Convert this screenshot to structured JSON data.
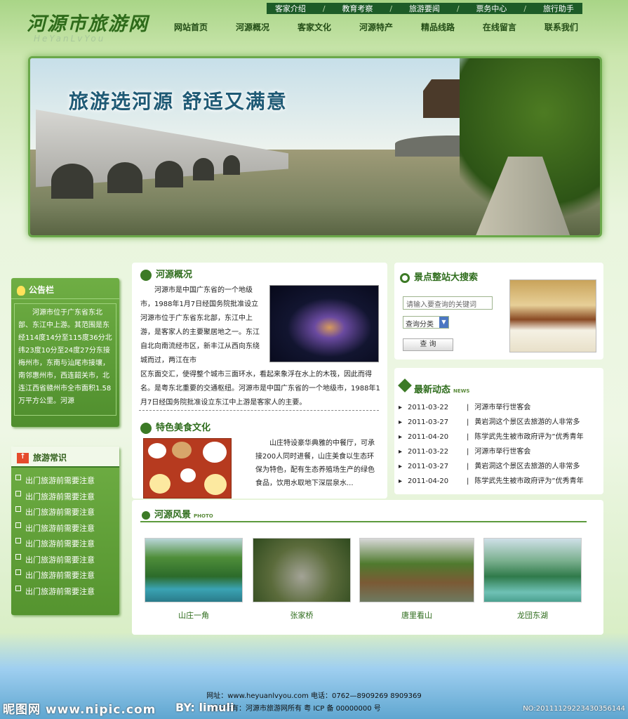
{
  "header": {
    "logo": "河源市旅游网",
    "logo_sub": "HeYanLvYou",
    "top_links": [
      "客家介绍",
      "教育考察",
      "旅游要闻",
      "票务中心",
      "旅行助手"
    ],
    "nav": [
      "网站首页",
      "河源概况",
      "客家文化",
      "河源特产",
      "精品线路",
      "在线留言",
      "联系我们"
    ]
  },
  "banner": {
    "slogan": "旅游选河源  舒适又满意"
  },
  "notice": {
    "title": "公告栏",
    "text": "河源市位于广东省东北部、东江中上游。其范围是东经114度14分至115度36分北纬23度10分至24度27分东接梅州市，东南与汕尾市接壤，南邻惠州市，西连韶关市，北连江西省赣州市全市面积1.58万平方公里。河源"
  },
  "tips": {
    "title": "旅游常识",
    "up": "↑",
    "items": [
      "出门旅游前需要注意",
      "出门旅游前需要注意",
      "出门旅游前需要注意",
      "出门旅游前需要注意",
      "出门旅游前需要注意",
      "出门旅游前需要注意",
      "出门旅游前需要注意",
      "出门旅游前需要注意"
    ]
  },
  "about": {
    "title": "河源概况",
    "text1": "河源市是中国广东省的一个地级市，1988年1月7日经国务院批准设立河源市位于广东省东北部，东江中上游，是客家人的主要聚居地之一。东江自北向南流经市区，新丰江从西向东绕城而过，两江在市",
    "text2": "区东面交汇，使得整个城市三面环水，看起来象浮在水上的木筏，因此而得名。是粤东北重要的交通枢纽。河源市是中国广东省的一个地级市，1988年1月7日经国务院批准设立东江中上游是客家人的主要。"
  },
  "food": {
    "title": "特色美食文化",
    "text": "山庄特设豪华典雅的中餐厅，可承接200人同时进餐，山庄美食以生态环保为特色，配有生态养殖场生产的绿色食品，饮用水取地下深层泉水..."
  },
  "search": {
    "title": "景点整站大搜索",
    "placeholder": "请输入要查询的关键词",
    "category": "查询分类",
    "button": "查 询"
  },
  "news": {
    "title": "最新动态",
    "title_en": "NEWS",
    "items": [
      {
        "date": "2011-03-22",
        "title": "河源市举行世客会"
      },
      {
        "date": "2011-03-27",
        "title": "黄岩洞这个景区去旅游的人非常多"
      },
      {
        "date": "2011-04-20",
        "title": "陈学武先生被市政府评为”优秀青年"
      },
      {
        "date": "2011-03-22",
        "title": "河源市举行世客会"
      },
      {
        "date": "2011-03-27",
        "title": "黄岩洞这个景区去旅游的人非常多"
      },
      {
        "date": "2011-04-20",
        "title": "陈学武先生被市政府评为”优秀青年"
      }
    ]
  },
  "scenery": {
    "title": "河源风景",
    "title_en": "PHOTO",
    "items": [
      "山庄一角",
      "张家桥",
      "唐里看山",
      "龙団东湖"
    ]
  },
  "footer": {
    "line1": "网址：www.heyuanlvyou.com  电话：0762—8909269  8909369",
    "line2": "版权所有：河源市旅游网所有  粤 ICP 备 00000000 号"
  },
  "watermark": {
    "site": "昵图网 www.nipic.com",
    "by": "BY: limuli",
    "no": "NO:20111129223430356144"
  }
}
